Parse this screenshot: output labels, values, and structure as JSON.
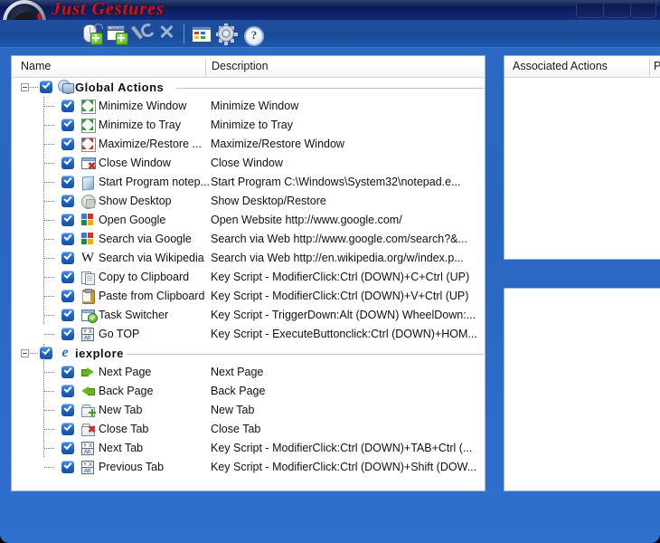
{
  "window": {
    "title": "Just Gestures",
    "minimize_label": "",
    "maximize_label": "",
    "close_label": ""
  },
  "toolbar": {
    "items": [
      {
        "name": "add-gesture-button",
        "icon": "mouse-plus-icon",
        "label": ""
      },
      {
        "name": "add-application-button",
        "icon": "window-plus-icon",
        "label": ""
      },
      {
        "name": "edit-button",
        "icon": "wrench-icon",
        "label": ""
      },
      {
        "name": "delete-button",
        "icon": "x-delete-icon",
        "label": ""
      },
      {
        "name": "list-view-button",
        "icon": "list-icon",
        "label": ""
      },
      {
        "name": "options-button",
        "icon": "gear-icon",
        "label": ""
      },
      {
        "name": "help-button",
        "icon": "question-mark-icon",
        "label": "?"
      }
    ]
  },
  "left_panel": {
    "columns": [
      {
        "key": "name",
        "label": "Name"
      },
      {
        "key": "description",
        "label": "Description"
      }
    ],
    "groups": [
      {
        "label": "Global Actions",
        "icon": "globe-monitor-icon",
        "checked": true,
        "expanded": true,
        "rows": [
          {
            "icon": "minimize-window-icon",
            "name": "Minimize Window",
            "description": "Minimize Window",
            "checked": true
          },
          {
            "icon": "minimize-tray-icon",
            "name": "Minimize to Tray",
            "description": "Minimize to Tray",
            "checked": true
          },
          {
            "icon": "maximize-restore-icon",
            "name": "Maximize/Restore ...",
            "description": "Maximize/Restore Window",
            "checked": true
          },
          {
            "icon": "close-window-icon",
            "name": "Close Window",
            "description": "Close Window",
            "checked": true
          },
          {
            "icon": "notepad-icon",
            "name": "Start Program notep...",
            "description": "Start Program C:\\Windows\\System32\\notepad.e...",
            "checked": true
          },
          {
            "icon": "show-desktop-icon",
            "name": "Show Desktop",
            "description": "Show Desktop/Restore",
            "checked": true
          },
          {
            "icon": "google-icon",
            "name": "Open Google",
            "description": "Open Website http://www.google.com/",
            "checked": true
          },
          {
            "icon": "google-icon",
            "name": "Search via Google",
            "description": "Search via Web http://www.google.com/search?&...",
            "checked": true
          },
          {
            "icon": "wikipedia-icon",
            "name": "Search via Wikipedia",
            "description": "Search via Web http://en.wikipedia.org/w/index.p...",
            "checked": true
          },
          {
            "icon": "copy-icon",
            "name": "Copy to Clipboard",
            "description": "Key Script - ModifierClick:Ctrl (DOWN)+C+Ctrl (UP)",
            "checked": true
          },
          {
            "icon": "paste-icon",
            "name": "Paste from Clipboard",
            "description": "Key Script - ModifierClick:Ctrl (DOWN)+V+Ctrl (UP)",
            "checked": true
          },
          {
            "icon": "task-switcher-icon",
            "name": "Task Switcher",
            "description": "Key Script - TriggerDown:Alt (DOWN) WheelDown:...",
            "checked": true
          },
          {
            "icon": "key-script-icon",
            "name": "Go TOP",
            "description": "Key Script - ExecuteButtonclick:Ctrl (DOWN)+HOM...",
            "checked": true
          }
        ]
      },
      {
        "label": "iexplore",
        "icon": "internet-explorer-icon",
        "checked": true,
        "expanded": true,
        "rows": [
          {
            "icon": "next-page-icon",
            "name": "Next Page",
            "description": "Next Page",
            "checked": true
          },
          {
            "icon": "back-page-icon",
            "name": "Back Page",
            "description": "Back Page",
            "checked": true
          },
          {
            "icon": "new-tab-icon",
            "name": "New Tab",
            "description": "New Tab",
            "checked": true
          },
          {
            "icon": "close-tab-icon",
            "name": "Close Tab",
            "description": "Close Tab",
            "checked": true
          },
          {
            "icon": "key-script-icon",
            "name": "Next Tab",
            "description": "Key Script - ModifierClick:Ctrl (DOWN)+TAB+Ctrl (...",
            "checked": true
          },
          {
            "icon": "key-script-icon",
            "name": "Previous Tab",
            "description": "Key Script - ModifierClick:Ctrl (DOWN)+Shift (DOW...",
            "checked": true
          }
        ]
      }
    ]
  },
  "right_top_panel": {
    "columns": [
      {
        "key": "associated_actions",
        "label": "Associated Actions"
      },
      {
        "key": "pr",
        "label": "Pr"
      }
    ],
    "rows": []
  },
  "right_bottom_panel": {
    "rows": []
  },
  "colors": {
    "window_background": "#2a66c0",
    "titlebar": "#0d1d5c",
    "title_text": "#c2182a",
    "toolbar": "#1a4a98",
    "panel_background": "#ffffff",
    "checkbox": "#1f63bf",
    "tree_line": "#5b7ea8"
  }
}
